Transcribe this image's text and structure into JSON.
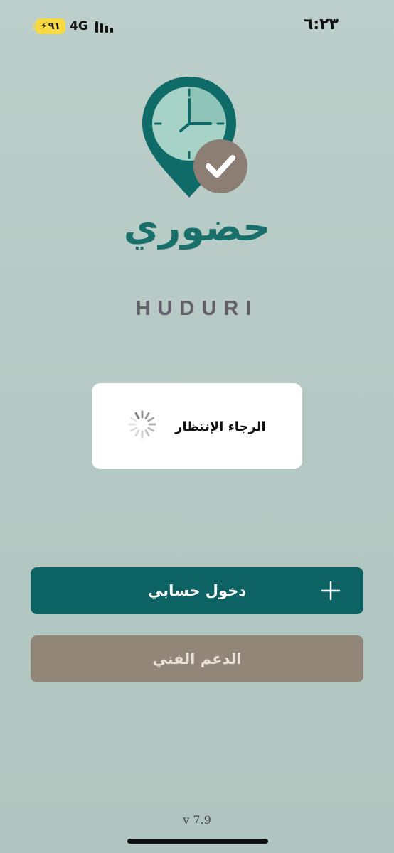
{
  "status_bar": {
    "time": "٦:٢٣",
    "battery": "٩١",
    "network": "4G"
  },
  "brand": {
    "name_ar": "حضوري",
    "name_en": "HUDURI"
  },
  "loading": {
    "text": "الرجاء الإنتظار"
  },
  "buttons": {
    "login": "دخول حسابي",
    "support": "الدعم الفني"
  },
  "icons": {
    "logo": "clock-location-pin-check-icon",
    "spinner": "loading-spinner-icon",
    "plus": "plus-icon",
    "battery": "battery-charging-icon",
    "signal": "cellular-signal-icon"
  },
  "colors": {
    "background": "#b6cac5",
    "primary": "#0d6264",
    "brand_text": "#19706b",
    "support_button": "#928678",
    "check_badge": "#8c7e72",
    "battery": "#f7d943"
  },
  "version": "v 7.9"
}
